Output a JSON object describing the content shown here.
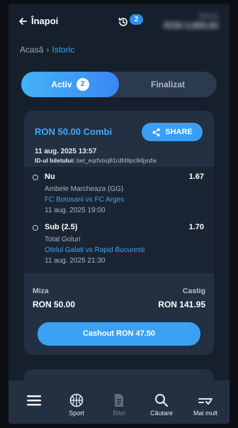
{
  "header": {
    "back_label": "Înapoi",
    "history_count": "2",
    "balance_label": "Balanța",
    "balance_value": "RON 3,805.60"
  },
  "breadcrumb": {
    "home": "Acasă",
    "current": "Istoric"
  },
  "tabs": [
    {
      "label": "Activ",
      "badge": "2",
      "active": true
    },
    {
      "label": "Finalizat",
      "active": false
    }
  ],
  "bet": {
    "title": "RON 50.00 Combi",
    "share_label": "SHARE",
    "date": "11 aug. 2025 13:57",
    "ticket_label": "ID-ul biletului:",
    "ticket_id": "bet_eqrfxlxq81rdfd9pc94jyufw",
    "selections": [
      {
        "pick": "Nu",
        "odds": "1.67",
        "market": "Ambele Marcheaza (GG)",
        "match": "FC Botosani vs FC Arges",
        "time": "11 aug. 2025 19:00"
      },
      {
        "pick": "Sub (2.5)",
        "odds": "1.70",
        "market": "Total Goluri",
        "match": "Otelul Galati vs Rapid Bucuresti",
        "time": "11 aug. 2025 21:30"
      }
    ],
    "stake_label": "Miza",
    "stake_value": "RON 50.00",
    "win_label": "Castig",
    "win_value": "RON 141.95",
    "cashout_label": "Cashout RON 47.50"
  },
  "nav": [
    {
      "icon": "menu-icon",
      "label": ""
    },
    {
      "icon": "basketball-icon",
      "label": "Sport"
    },
    {
      "icon": "ticket-icon",
      "label": "Bilet"
    },
    {
      "icon": "search-icon",
      "label": "Căutare"
    },
    {
      "icon": "more-icon",
      "label": "Mai mult"
    }
  ],
  "colors": {
    "accent": "#3ba2f3",
    "background": "#15202c",
    "card": "#223042"
  }
}
